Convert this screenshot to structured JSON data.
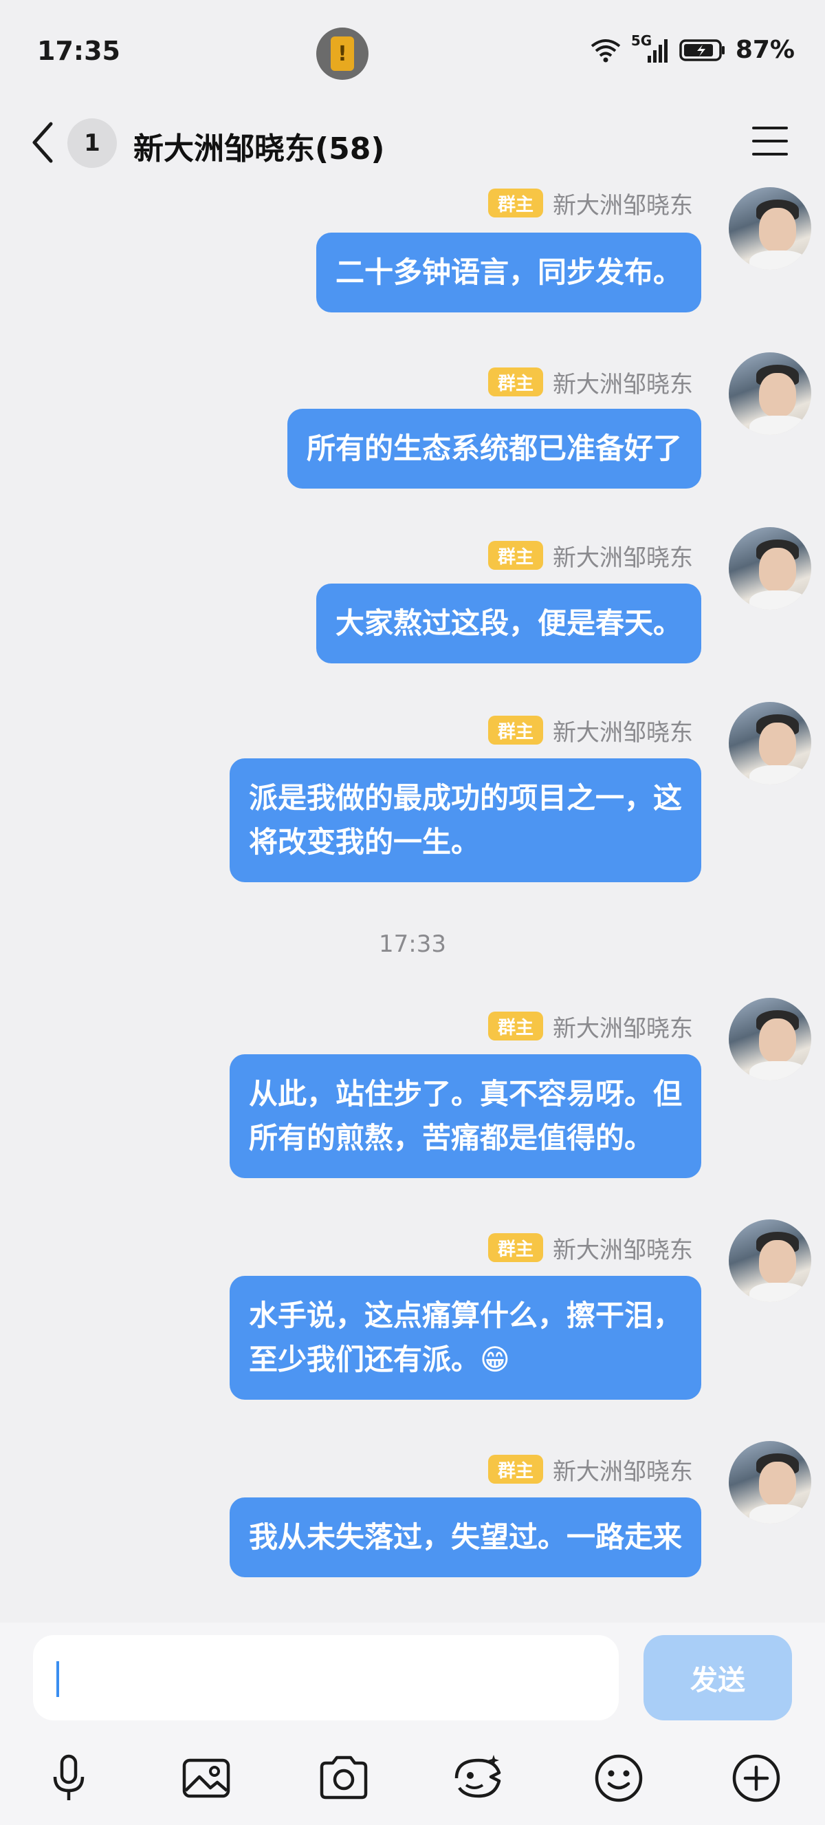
{
  "status_bar": {
    "time": "17:35",
    "network": "5G",
    "battery_percent": "87%",
    "battery_level": 0.87
  },
  "header": {
    "unread_count": "1",
    "title": "新大洲邹晓东(58)"
  },
  "messages": [
    {
      "role_tag": "群主",
      "sender": "新大洲邹晓东",
      "text": "二十多钟语言，同步发布。"
    },
    {
      "role_tag": "群主",
      "sender": "新大洲邹晓东",
      "text": "所有的生态系统都已准备好了"
    },
    {
      "role_tag": "群主",
      "sender": "新大洲邹晓东",
      "text": "大家熬过这段，便是春天。"
    },
    {
      "role_tag": "群主",
      "sender": "新大洲邹晓东",
      "lines": [
        "派是我做的最成功的项目之一，这",
        "将改变我的一生。"
      ]
    },
    {
      "role_tag": "群主",
      "sender": "新大洲邹晓东",
      "lines": [
        "从此，站住步了。真不容易呀。但",
        "所有的煎熬，苦痛都是值得的。"
      ]
    },
    {
      "role_tag": "群主",
      "sender": "新大洲邹晓东",
      "lines": [
        "水手说，这点痛算什么，擦干泪，",
        "至少我们还有派。😁"
      ]
    },
    {
      "role_tag": "群主",
      "sender": "新大洲邹晓东",
      "text": "我从未失落过，失望过。一路走来"
    }
  ],
  "timestamp": "17:33",
  "input": {
    "value": "",
    "send_label": "发送"
  },
  "toolbar": [
    "microphone-icon",
    "image-icon",
    "camera-icon",
    "sticker-icon",
    "emoji-icon",
    "plus-icon"
  ],
  "colors": {
    "bubble": "#4d95f2",
    "role_tag": "#f7c545",
    "send_disabled": "#a9cef7",
    "background": "#f0f0f2"
  }
}
